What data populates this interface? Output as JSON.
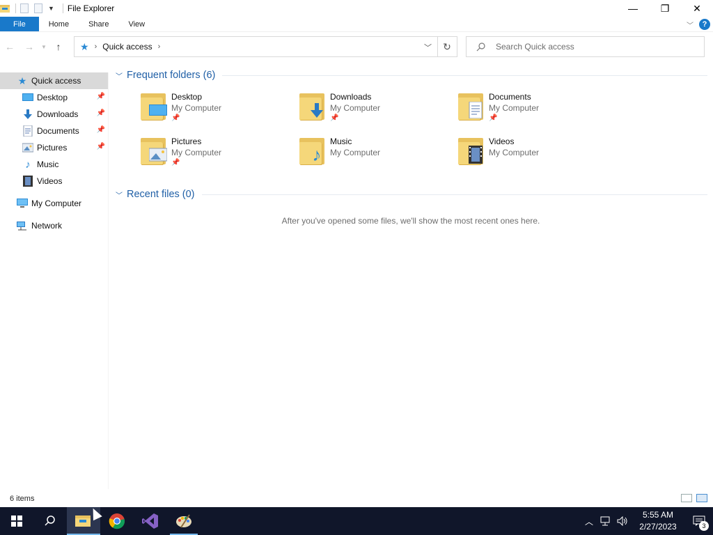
{
  "window": {
    "title": "File Explorer",
    "controls": {
      "minimize": "—",
      "restore": "❐",
      "close": "✕"
    }
  },
  "ribbon": {
    "tabs": [
      "File",
      "Home",
      "Share",
      "View"
    ],
    "help": "?"
  },
  "address": {
    "crumb": "Quick access",
    "search_placeholder": "Search Quick access"
  },
  "sidebar": {
    "quick_access": "Quick access",
    "pinned": [
      {
        "label": "Desktop",
        "icon": "desktop-icon"
      },
      {
        "label": "Downloads",
        "icon": "downloads-icon"
      },
      {
        "label": "Documents",
        "icon": "documents-icon"
      },
      {
        "label": "Pictures",
        "icon": "pictures-icon"
      }
    ],
    "music": "Music",
    "videos": "Videos",
    "my_computer": "My Computer",
    "network": "Network"
  },
  "frequent": {
    "title": "Frequent folders (6)",
    "items": [
      {
        "name": "Desktop",
        "location": "My Computer",
        "pinned": true
      },
      {
        "name": "Downloads",
        "location": "My Computer",
        "pinned": true
      },
      {
        "name": "Documents",
        "location": "My Computer",
        "pinned": true
      },
      {
        "name": "Pictures",
        "location": "My Computer",
        "pinned": true
      },
      {
        "name": "Music",
        "location": "My Computer",
        "pinned": false
      },
      {
        "name": "Videos",
        "location": "My Computer",
        "pinned": false
      }
    ]
  },
  "recent": {
    "title": "Recent files (0)",
    "empty_message": "After you've opened some files, we'll show the most recent ones here."
  },
  "status": {
    "item_count": "6 items"
  },
  "taskbar": {
    "time": "5:55 AM",
    "date": "2/27/2023",
    "notification_count": "3"
  },
  "colors": {
    "accent": "#1979ca",
    "group_header": "#1f5fa6",
    "taskbar": "#10162a",
    "sidebar_selected": "#d9d9d9",
    "folder": "#f5d77a"
  }
}
